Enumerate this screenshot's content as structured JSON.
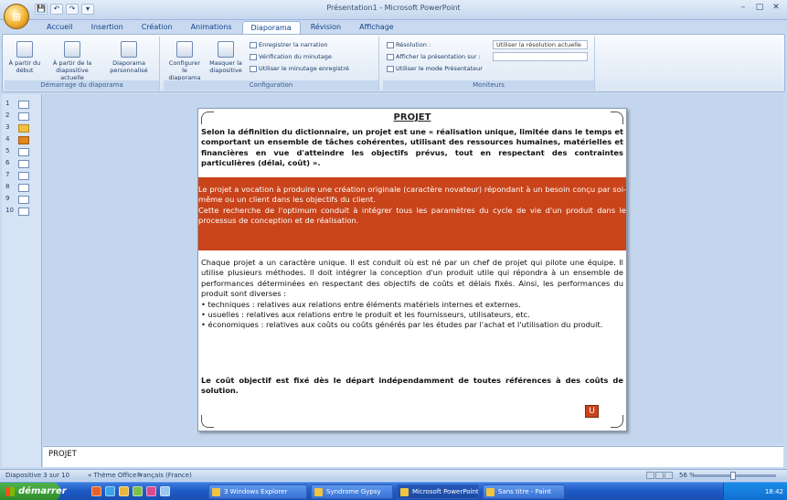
{
  "app": {
    "title": "Présentation1 - Microsoft PowerPoint",
    "office_button": "⊞",
    "qat": [
      "💾",
      "↶",
      "↷",
      "▾"
    ],
    "window_controls": [
      "–",
      "□",
      "✕"
    ]
  },
  "tabs": [
    "Accueil",
    "Insertion",
    "Création",
    "Animations",
    "Diaporama",
    "Révision",
    "Affichage"
  ],
  "active_tab_index": 4,
  "ribbon": {
    "groups": [
      {
        "label": "Démarrage du diaporama",
        "buttons": [
          "À partir du début",
          "À partir de la diapositive actuelle",
          "Diaporama personnalisé"
        ]
      },
      {
        "label": "Configuration",
        "buttons": [
          "Configurer le diaporama",
          "Masquer la diapositive"
        ],
        "small": [
          "Enregistrer la narration",
          "Vérification du minutage",
          "Utiliser le minutage enregistré"
        ]
      },
      {
        "label": "Moniteurs",
        "small": [
          "Résolution :",
          "Afficher la présentation sur :",
          "Utiliser le mode Présentateur"
        ],
        "dropdowns": [
          "Utiliser la résolution actuelle",
          ""
        ]
      }
    ]
  },
  "slides_panel": {
    "thumbs": [
      "1",
      "2",
      "3",
      "4",
      "5",
      "6",
      "7",
      "8",
      "9",
      "10"
    ],
    "selected_index": 2,
    "active_index": 3
  },
  "slide": {
    "title": "PROJET",
    "para1": "Selon la définition du dictionnaire, un projet est une « réalisation unique, limitée dans le temps et comportant un ensemble de tâches cohérentes, utilisant des ressources humaines, matérielles et financières en vue d'atteindre les objectifs prévus, tout en respectant des contraintes particulières (délai, coût) ».",
    "band1": "Le projet a vocation à produire une création originale (caractère novateur) répondant à un besoin conçu par soi-même ou un client dans les objectifs du client.",
    "band2": "Cette recherche de l'optimum conduit à intégrer tous les paramètres du cycle de vie d'un produit dans le processus de conception et de réalisation.",
    "para2": "Chaque projet a un caractère unique. Il est conduit où est né par un chef de projet qui pilote une équipe. Il utilise plusieurs méthodes. Il doit intégrer la conception d'un produit utile qui répondra à un ensemble de performances déterminées en respectant des objectifs de coûts et délais fixés. Ainsi, les performances du produit sont diverses :",
    "bullets": [
      "• techniques : relatives aux relations entre éléments matériels internes et externes.",
      "• usuelles : relatives aux relations entre le produit et les fournisseurs, utilisateurs, etc.",
      "• économiques : relatives aux coûts ou coûts générés par les études par l'achat et l'utilisation du produit."
    ],
    "para3": "Le coût objectif est fixé dès le départ indépendamment de toutes références à des coûts de solution.",
    "button_label": "U"
  },
  "notes": {
    "text": "PROJET"
  },
  "statusbar": {
    "slide_info": "Diapositive 3 sur 10",
    "theme": "« Thème Office »",
    "language": "Français (France)",
    "zoom": "56 %"
  },
  "taskbar": {
    "start": "démarrer",
    "quick_colors": [
      "#e6622a",
      "#3ca3e8",
      "#e8b737",
      "#7ec04a",
      "#d94b8c",
      "#9ec6f2"
    ],
    "tasks": [
      "3 Windows Explorer",
      "Syndrome Gypsy",
      "Microsoft PowerPoint",
      "Sans titre - Paint"
    ],
    "active_task_index": 2,
    "clock": "18:42"
  }
}
